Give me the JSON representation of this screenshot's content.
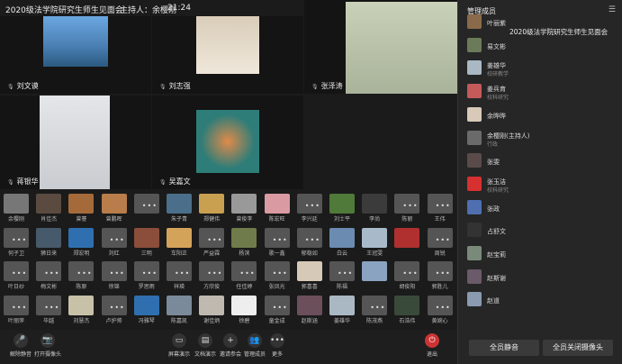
{
  "topbar": {
    "meeting": "2020级法学院研究生师生见面会",
    "host": "主持人：余樱刚",
    "time": "21:24"
  },
  "videos": [
    {
      "name": "刘文谟",
      "color": "#4a7fb3"
    },
    {
      "name": "刘志强",
      "color": "#e9dfcf"
    },
    {
      "name": "张泽涛",
      "color": "#b9c3a8"
    },
    {
      "name": "蒋银华",
      "color": "#cfd2d6"
    },
    {
      "name": "吴嘉文",
      "color": "#2f7d78"
    }
  ],
  "grid_rows": [
    [
      {
        "l": "余樱刚",
        "c": "#777"
      },
      {
        "l": "肖佳杰",
        "c": "#5b4a3f"
      },
      {
        "l": "曾謇",
        "c": "#a56a3a"
      },
      {
        "l": "曾鹏晖",
        "c": "#b87d4a"
      },
      {
        "l": "",
        "c": "#555",
        "d": 1
      },
      {
        "l": "朱子青",
        "c": "#4b6f8a"
      },
      {
        "l": "郑健伟",
        "c": "#c9a050"
      },
      {
        "l": "曾俊李",
        "c": "#999"
      },
      {
        "l": "陈宏旺",
        "c": "#d99aa2"
      },
      {
        "l": "李兴廷",
        "c": "#555",
        "d": 1
      },
      {
        "l": "刘士平",
        "c": "#4f7a3a"
      },
      {
        "l": "李尚",
        "c": "#3b3b3b"
      },
      {
        "l": "陈丽",
        "c": "#555",
        "d": 1
      },
      {
        "l": "王伟",
        "c": "#555",
        "d": 1
      },
      {
        "l": "黎沈福",
        "c": "#fff"
      }
    ],
    [
      {
        "l": "何子卫",
        "c": "#555",
        "d": 1
      },
      {
        "l": "狮日来",
        "c": "#475a6b"
      },
      {
        "l": "郑宏明",
        "c": "#2f6fb0"
      },
      {
        "l": "刘红",
        "c": "#555",
        "d": 1
      },
      {
        "l": "三明",
        "c": "#8a4e3a"
      },
      {
        "l": "车阳正",
        "c": "#d4a35a"
      },
      {
        "l": "严益霖",
        "c": "#555",
        "d": 1
      },
      {
        "l": "杨滨",
        "c": "#6f7b4a"
      },
      {
        "l": "歌一鑫",
        "c": "#555",
        "d": 1
      },
      {
        "l": "郁稳如",
        "c": "#555",
        "d": 1
      },
      {
        "l": "白云",
        "c": "#6b8bb0"
      },
      {
        "l": "王冠雯",
        "c": "#a8b9c9"
      },
      {
        "l": "",
        "c": "#b03030"
      },
      {
        "l": "周锐",
        "c": "#555",
        "d": 1
      }
    ],
    [
      {
        "l": "叶日纱",
        "c": "#555",
        "d": 1
      },
      {
        "l": "梅文彬",
        "c": "#555",
        "d": 1
      },
      {
        "l": "陈原",
        "c": "#555",
        "d": 1
      },
      {
        "l": "徐锦",
        "c": "#555",
        "d": 1
      },
      {
        "l": "罗思雨",
        "c": "#555",
        "d": 1
      },
      {
        "l": "祥瑛",
        "c": "#555",
        "d": 1
      },
      {
        "l": "方欣俊",
        "c": "#555",
        "d": 1
      },
      {
        "l": "任佳婷",
        "c": "#555",
        "d": 1
      },
      {
        "l": "张凤光",
        "c": "#555",
        "d": 1
      },
      {
        "l": "郭喜喜",
        "c": "#d7c9b8"
      },
      {
        "l": "陈福",
        "c": "#555",
        "d": 1
      },
      {
        "l": "",
        "c": "#8aa3c0"
      },
      {
        "l": "胡俊阳",
        "c": "#555",
        "d": 1
      },
      {
        "l": "郭胜儿",
        "c": "#555",
        "d": 1
      }
    ],
    [
      {
        "l": "叶丽萍",
        "c": "#555",
        "d": 1
      },
      {
        "l": "毕越",
        "c": "#555",
        "d": 1
      },
      {
        "l": "刘慧杰",
        "c": "#c7c1a8"
      },
      {
        "l": "卢护帅",
        "c": "#555",
        "d": 1
      },
      {
        "l": "冯雅琴",
        "c": "#2f6fb0"
      },
      {
        "l": "陈嘉凯",
        "c": "#7a8a9a"
      },
      {
        "l": "谢佳炳",
        "c": "#c0b9b0"
      },
      {
        "l": "徐碧",
        "c": "#eee"
      },
      {
        "l": "童金成",
        "c": "#555",
        "d": 1
      },
      {
        "l": "赵斯涵",
        "c": "#6b4f5a"
      },
      {
        "l": "姜雄华",
        "c": "#aab8c3"
      },
      {
        "l": "陈茂燕",
        "c": "#555",
        "d": 1
      },
      {
        "l": "石浩伟",
        "c": "#3a4a3a"
      },
      {
        "l": "黄婉心",
        "c": "#555",
        "d": 1
      }
    ]
  ],
  "toolbar": {
    "left": [
      {
        "name": "unmute-button",
        "label": "解除静音",
        "icon": "🎤"
      },
      {
        "name": "camera-button",
        "label": "打开摄像头",
        "icon": "📷"
      }
    ],
    "center": [
      {
        "name": "share-screen-button",
        "label": "屏幕演示",
        "icon": "▭"
      },
      {
        "name": "doc-button",
        "label": "文档演示",
        "icon": "▤"
      },
      {
        "name": "invite-button",
        "label": "邀请参会",
        "icon": "+"
      },
      {
        "name": "members-button",
        "label": "管理成员",
        "icon": "👥"
      },
      {
        "name": "more-button",
        "label": "更多",
        "icon": "•••"
      }
    ],
    "exit": {
      "label": "退出",
      "icon": "⏻"
    }
  },
  "panel": {
    "title": "管理成员",
    "overlay_title": "2020级法学院研究生师生见面会",
    "members": [
      {
        "name": "叶丽紫",
        "role": "",
        "c": "#8a6a4a"
      },
      {
        "name": "易文彬",
        "role": "",
        "c": "#6b7b5a"
      },
      {
        "name": "姜雄华",
        "role": "校研教学",
        "c": "#aab8c3"
      },
      {
        "name": "姜兵育",
        "role": "校科研究",
        "c": "#c45a5a"
      },
      {
        "name": "余晔晔",
        "role": "",
        "c": "#d8c9b9"
      },
      {
        "name": "余樱刚(主持人)",
        "role": "行政",
        "c": "#6a6a6a"
      },
      {
        "name": "张雯",
        "role": "",
        "c": "#5a4a4a"
      },
      {
        "name": "张玉洁",
        "role": "校科研究",
        "c": "#d63030"
      },
      {
        "name": "张政",
        "role": "",
        "c": "#4f6fb0"
      },
      {
        "name": "占舒文",
        "role": "",
        "c": "#333"
      },
      {
        "name": "赵宝莉",
        "role": "",
        "c": "#7a8a7a"
      },
      {
        "name": "赵斯谢",
        "role": "",
        "c": "#6b5a6a"
      },
      {
        "name": "赵道",
        "role": "",
        "c": "#8a9ab0"
      }
    ],
    "mute_all": "全员静音",
    "cams_off": "全员关闭摄像头"
  }
}
